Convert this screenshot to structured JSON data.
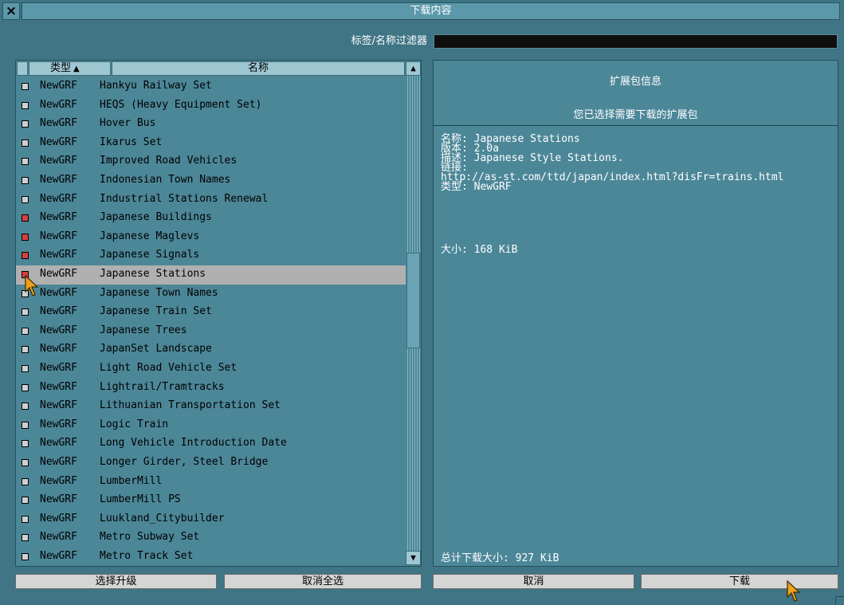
{
  "window": {
    "title": "下载内容",
    "close_glyph": "×"
  },
  "filter": {
    "label": "标签/名称过滤器",
    "value": ""
  },
  "list": {
    "header": {
      "type_label": "类型",
      "sort_arrow": "▲",
      "name_label": "名称"
    },
    "rows": [
      {
        "type": "NewGRF",
        "name": "Hankyu Railway Set",
        "checked": false,
        "selected": false
      },
      {
        "type": "NewGRF",
        "name": "HEQS (Heavy Equipment Set)",
        "checked": false,
        "selected": false
      },
      {
        "type": "NewGRF",
        "name": "Hover Bus",
        "checked": false,
        "selected": false
      },
      {
        "type": "NewGRF",
        "name": "Ikarus Set",
        "checked": false,
        "selected": false
      },
      {
        "type": "NewGRF",
        "name": "Improved Road Vehicles",
        "checked": false,
        "selected": false
      },
      {
        "type": "NewGRF",
        "name": "Indonesian Town Names",
        "checked": false,
        "selected": false
      },
      {
        "type": "NewGRF",
        "name": "Industrial Stations Renewal",
        "checked": false,
        "selected": false
      },
      {
        "type": "NewGRF",
        "name": "Japanese Buildings",
        "checked": true,
        "selected": false
      },
      {
        "type": "NewGRF",
        "name": "Japanese Maglevs",
        "checked": true,
        "selected": false
      },
      {
        "type": "NewGRF",
        "name": "Japanese Signals",
        "checked": true,
        "selected": false
      },
      {
        "type": "NewGRF",
        "name": "Japanese Stations",
        "checked": true,
        "selected": true
      },
      {
        "type": "NewGRF",
        "name": "Japanese Town Names",
        "checked": false,
        "selected": false
      },
      {
        "type": "NewGRF",
        "name": "Japanese Train Set",
        "checked": false,
        "selected": false
      },
      {
        "type": "NewGRF",
        "name": "Japanese Trees",
        "checked": false,
        "selected": false
      },
      {
        "type": "NewGRF",
        "name": "JapanSet Landscape",
        "checked": false,
        "selected": false
      },
      {
        "type": "NewGRF",
        "name": "Light Road Vehicle Set",
        "checked": false,
        "selected": false
      },
      {
        "type": "NewGRF",
        "name": "Lightrail/Tramtracks",
        "checked": false,
        "selected": false
      },
      {
        "type": "NewGRF",
        "name": "Lithuanian Transportation Set",
        "checked": false,
        "selected": false
      },
      {
        "type": "NewGRF",
        "name": "Logic Train",
        "checked": false,
        "selected": false
      },
      {
        "type": "NewGRF",
        "name": "Long Vehicle Introduction Date",
        "checked": false,
        "selected": false
      },
      {
        "type": "NewGRF",
        "name": "Longer Girder, Steel Bridge",
        "checked": false,
        "selected": false
      },
      {
        "type": "NewGRF",
        "name": "LumberMill",
        "checked": false,
        "selected": false
      },
      {
        "type": "NewGRF",
        "name": "LumberMill PS",
        "checked": false,
        "selected": false
      },
      {
        "type": "NewGRF",
        "name": "Luukland_Citybuilder",
        "checked": false,
        "selected": false
      },
      {
        "type": "NewGRF",
        "name": "Metro Subway Set",
        "checked": false,
        "selected": false
      },
      {
        "type": "NewGRF",
        "name": "Metro Track Set",
        "checked": false,
        "selected": false
      }
    ],
    "scroll_up_glyph": "▲",
    "scroll_down_glyph": "▼"
  },
  "info": {
    "title": "扩展包信息",
    "subtitle": "您已选择需要下载的扩展包",
    "name_line": "名称: Japanese Stations",
    "version_line": "版本: 2.0a",
    "desc_line": "描述: Japanese Style Stations.",
    "link_label": "链接:",
    "link_url": "http://as-st.com/ttd/japan/index.html?disFr=trains.html",
    "type_line": "类型: NewGRF",
    "size_line": "大小: 168 KiB",
    "total_line": "总计下载大小: 927 KiB"
  },
  "buttons": {
    "select_upgrade": "选择升级",
    "unselect_all": "取消全选",
    "cancel": "取消",
    "download": "下载"
  },
  "colors": {
    "window_bg": "#3f7585",
    "panel_bg": "#4c8798",
    "selected_row": "#b0b0b0",
    "checkbox_checked": "#d64040",
    "cursor": "#f0a020"
  }
}
